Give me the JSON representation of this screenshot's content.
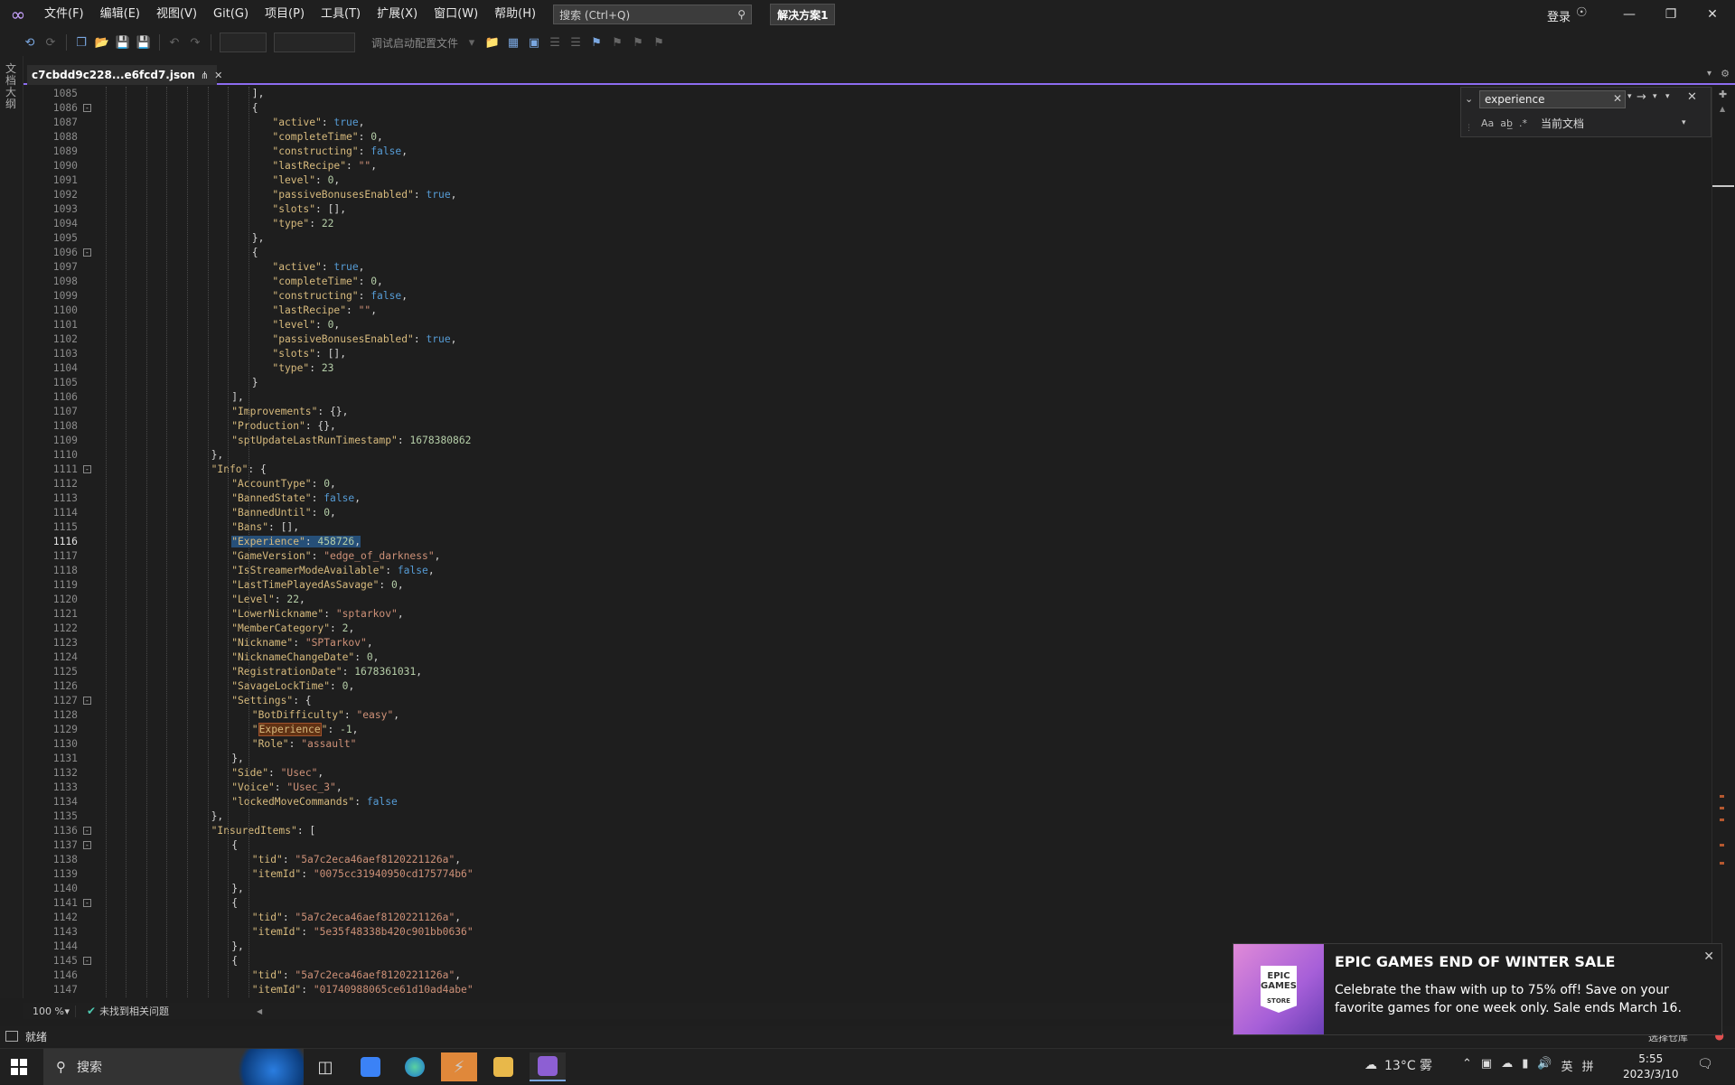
{
  "menubar": {
    "items": [
      "文件(F)",
      "编辑(E)",
      "视图(V)",
      "Git(G)",
      "项目(P)",
      "工具(T)",
      "扩展(X)",
      "窗口(W)",
      "帮助(H)"
    ],
    "search_placeholder": "搜索 (Ctrl+Q)",
    "solution_name": "解决方案1",
    "login_label": "登录"
  },
  "toolbar": {
    "debug_profile": "调试启动配置文件"
  },
  "sidebar": {
    "label": "文档大纲"
  },
  "tab": {
    "title": "c7cbdd9c228...e6fcd7.json"
  },
  "find": {
    "query": "experience",
    "scope": "当前文档",
    "match_case": "Aa",
    "whole_word": "ab̲",
    "regex": ".*"
  },
  "editor": {
    "current_line": 1116,
    "lines": [
      {
        "n": 1085,
        "i": 8,
        "t": [
          [
            "p",
            "],"
          ]
        ]
      },
      {
        "n": 1086,
        "i": 8,
        "t": [
          [
            "p",
            "{"
          ]
        ],
        "fold": true
      },
      {
        "n": 1087,
        "i": 9,
        "t": [
          [
            "k",
            "\"active\""
          ],
          [
            "p",
            ": "
          ],
          [
            "b",
            "true"
          ],
          [
            "p",
            ","
          ]
        ]
      },
      {
        "n": 1088,
        "i": 9,
        "t": [
          [
            "k",
            "\"completeTime\""
          ],
          [
            "p",
            ": "
          ],
          [
            "n",
            "0"
          ],
          [
            "p",
            ","
          ]
        ]
      },
      {
        "n": 1089,
        "i": 9,
        "t": [
          [
            "k",
            "\"constructing\""
          ],
          [
            "p",
            ": "
          ],
          [
            "b",
            "false"
          ],
          [
            "p",
            ","
          ]
        ]
      },
      {
        "n": 1090,
        "i": 9,
        "t": [
          [
            "k",
            "\"lastRecipe\""
          ],
          [
            "p",
            ": "
          ],
          [
            "s",
            "\"\""
          ],
          [
            "p",
            ","
          ]
        ]
      },
      {
        "n": 1091,
        "i": 9,
        "t": [
          [
            "k",
            "\"level\""
          ],
          [
            "p",
            ": "
          ],
          [
            "n",
            "0"
          ],
          [
            "p",
            ","
          ]
        ]
      },
      {
        "n": 1092,
        "i": 9,
        "t": [
          [
            "k",
            "\"passiveBonusesEnabled\""
          ],
          [
            "p",
            ": "
          ],
          [
            "b",
            "true"
          ],
          [
            "p",
            ","
          ]
        ]
      },
      {
        "n": 1093,
        "i": 9,
        "t": [
          [
            "k",
            "\"slots\""
          ],
          [
            "p",
            ": [],"
          ]
        ]
      },
      {
        "n": 1094,
        "i": 9,
        "t": [
          [
            "k",
            "\"type\""
          ],
          [
            "p",
            ": "
          ],
          [
            "n",
            "22"
          ]
        ]
      },
      {
        "n": 1095,
        "i": 8,
        "t": [
          [
            "p",
            "},"
          ]
        ]
      },
      {
        "n": 1096,
        "i": 8,
        "t": [
          [
            "p",
            "{"
          ]
        ],
        "fold": true
      },
      {
        "n": 1097,
        "i": 9,
        "t": [
          [
            "k",
            "\"active\""
          ],
          [
            "p",
            ": "
          ],
          [
            "b",
            "true"
          ],
          [
            "p",
            ","
          ]
        ]
      },
      {
        "n": 1098,
        "i": 9,
        "t": [
          [
            "k",
            "\"completeTime\""
          ],
          [
            "p",
            ": "
          ],
          [
            "n",
            "0"
          ],
          [
            "p",
            ","
          ]
        ]
      },
      {
        "n": 1099,
        "i": 9,
        "t": [
          [
            "k",
            "\"constructing\""
          ],
          [
            "p",
            ": "
          ],
          [
            "b",
            "false"
          ],
          [
            "p",
            ","
          ]
        ]
      },
      {
        "n": 1100,
        "i": 9,
        "t": [
          [
            "k",
            "\"lastRecipe\""
          ],
          [
            "p",
            ": "
          ],
          [
            "s",
            "\"\""
          ],
          [
            "p",
            ","
          ]
        ]
      },
      {
        "n": 1101,
        "i": 9,
        "t": [
          [
            "k",
            "\"level\""
          ],
          [
            "p",
            ": "
          ],
          [
            "n",
            "0"
          ],
          [
            "p",
            ","
          ]
        ]
      },
      {
        "n": 1102,
        "i": 9,
        "t": [
          [
            "k",
            "\"passiveBonusesEnabled\""
          ],
          [
            "p",
            ": "
          ],
          [
            "b",
            "true"
          ],
          [
            "p",
            ","
          ]
        ]
      },
      {
        "n": 1103,
        "i": 9,
        "t": [
          [
            "k",
            "\"slots\""
          ],
          [
            "p",
            ": [],"
          ]
        ]
      },
      {
        "n": 1104,
        "i": 9,
        "t": [
          [
            "k",
            "\"type\""
          ],
          [
            "p",
            ": "
          ],
          [
            "n",
            "23"
          ]
        ]
      },
      {
        "n": 1105,
        "i": 8,
        "t": [
          [
            "p",
            "}"
          ]
        ]
      },
      {
        "n": 1106,
        "i": 7,
        "t": [
          [
            "p",
            "],"
          ]
        ]
      },
      {
        "n": 1107,
        "i": 7,
        "t": [
          [
            "k",
            "\"Improvements\""
          ],
          [
            "p",
            ": {},"
          ]
        ]
      },
      {
        "n": 1108,
        "i": 7,
        "t": [
          [
            "k",
            "\"Production\""
          ],
          [
            "p",
            ": {},"
          ]
        ]
      },
      {
        "n": 1109,
        "i": 7,
        "t": [
          [
            "k",
            "\"sptUpdateLastRunTimestamp\""
          ],
          [
            "p",
            ": "
          ],
          [
            "n",
            "1678380862"
          ]
        ]
      },
      {
        "n": 1110,
        "i": 6,
        "t": [
          [
            "p",
            "},"
          ]
        ]
      },
      {
        "n": 1111,
        "i": 6,
        "t": [
          [
            "k",
            "\"Info\""
          ],
          [
            "p",
            ": {"
          ]
        ],
        "fold": true
      },
      {
        "n": 1112,
        "i": 7,
        "t": [
          [
            "k",
            "\"AccountType\""
          ],
          [
            "p",
            ": "
          ],
          [
            "n",
            "0"
          ],
          [
            "p",
            ","
          ]
        ]
      },
      {
        "n": 1113,
        "i": 7,
        "t": [
          [
            "k",
            "\"BannedState\""
          ],
          [
            "p",
            ": "
          ],
          [
            "b",
            "false"
          ],
          [
            "p",
            ","
          ]
        ]
      },
      {
        "n": 1114,
        "i": 7,
        "t": [
          [
            "k",
            "\"BannedUntil\""
          ],
          [
            "p",
            ": "
          ],
          [
            "n",
            "0"
          ],
          [
            "p",
            ","
          ]
        ]
      },
      {
        "n": 1115,
        "i": 7,
        "t": [
          [
            "k",
            "\"Bans\""
          ],
          [
            "p",
            ": [],"
          ]
        ]
      },
      {
        "n": 1116,
        "i": 7,
        "t": [
          [
            "k hl",
            "\"Experience\""
          ],
          [
            "p hl",
            ": "
          ],
          [
            "n hl",
            "458726"
          ],
          [
            "p hl",
            ","
          ]
        ]
      },
      {
        "n": 1117,
        "i": 7,
        "t": [
          [
            "k",
            "\"GameVersion\""
          ],
          [
            "p",
            ": "
          ],
          [
            "s",
            "\"edge_of_darkness\""
          ],
          [
            "p",
            ","
          ]
        ]
      },
      {
        "n": 1118,
        "i": 7,
        "t": [
          [
            "k",
            "\"IsStreamerModeAvailable\""
          ],
          [
            "p",
            ": "
          ],
          [
            "b",
            "false"
          ],
          [
            "p",
            ","
          ]
        ]
      },
      {
        "n": 1119,
        "i": 7,
        "t": [
          [
            "k",
            "\"LastTimePlayedAsSavage\""
          ],
          [
            "p",
            ": "
          ],
          [
            "n",
            "0"
          ],
          [
            "p",
            ","
          ]
        ]
      },
      {
        "n": 1120,
        "i": 7,
        "t": [
          [
            "k",
            "\"Level\""
          ],
          [
            "p",
            ": "
          ],
          [
            "n",
            "22"
          ],
          [
            "p",
            ","
          ]
        ]
      },
      {
        "n": 1121,
        "i": 7,
        "t": [
          [
            "k",
            "\"LowerNickname\""
          ],
          [
            "p",
            ": "
          ],
          [
            "s",
            "\"sptarkov\""
          ],
          [
            "p",
            ","
          ]
        ]
      },
      {
        "n": 1122,
        "i": 7,
        "t": [
          [
            "k",
            "\"MemberCategory\""
          ],
          [
            "p",
            ": "
          ],
          [
            "n",
            "2"
          ],
          [
            "p",
            ","
          ]
        ]
      },
      {
        "n": 1123,
        "i": 7,
        "t": [
          [
            "k",
            "\"Nickname\""
          ],
          [
            "p",
            ": "
          ],
          [
            "s",
            "\"SPTarkov\""
          ],
          [
            "p",
            ","
          ]
        ]
      },
      {
        "n": 1124,
        "i": 7,
        "t": [
          [
            "k",
            "\"NicknameChangeDate\""
          ],
          [
            "p",
            ": "
          ],
          [
            "n",
            "0"
          ],
          [
            "p",
            ","
          ]
        ]
      },
      {
        "n": 1125,
        "i": 7,
        "t": [
          [
            "k",
            "\"RegistrationDate\""
          ],
          [
            "p",
            ": "
          ],
          [
            "n",
            "1678361031"
          ],
          [
            "p",
            ","
          ]
        ]
      },
      {
        "n": 1126,
        "i": 7,
        "t": [
          [
            "k",
            "\"SavageLockTime\""
          ],
          [
            "p",
            ": "
          ],
          [
            "n",
            "0"
          ],
          [
            "p",
            ","
          ]
        ]
      },
      {
        "n": 1127,
        "i": 7,
        "t": [
          [
            "k",
            "\"Settings\""
          ],
          [
            "p",
            ": {"
          ]
        ],
        "fold": true
      },
      {
        "n": 1128,
        "i": 8,
        "t": [
          [
            "k",
            "\"BotDifficulty\""
          ],
          [
            "p",
            ": "
          ],
          [
            "s",
            "\"easy\""
          ],
          [
            "p",
            ","
          ]
        ]
      },
      {
        "n": 1129,
        "i": 8,
        "t": [
          [
            "k",
            "\""
          ],
          [
            "k hl2",
            "Experience"
          ],
          [
            "k",
            "\""
          ],
          [
            "p",
            ": "
          ],
          [
            "n",
            "-1"
          ],
          [
            "p",
            ","
          ]
        ]
      },
      {
        "n": 1130,
        "i": 8,
        "t": [
          [
            "k",
            "\"Role\""
          ],
          [
            "p",
            ": "
          ],
          [
            "s",
            "\"assault\""
          ]
        ]
      },
      {
        "n": 1131,
        "i": 7,
        "t": [
          [
            "p",
            "},"
          ]
        ]
      },
      {
        "n": 1132,
        "i": 7,
        "t": [
          [
            "k",
            "\"Side\""
          ],
          [
            "p",
            ": "
          ],
          [
            "s",
            "\"Usec\""
          ],
          [
            "p",
            ","
          ]
        ]
      },
      {
        "n": 1133,
        "i": 7,
        "t": [
          [
            "k",
            "\"Voice\""
          ],
          [
            "p",
            ": "
          ],
          [
            "s",
            "\"Usec_3\""
          ],
          [
            "p",
            ","
          ]
        ]
      },
      {
        "n": 1134,
        "i": 7,
        "t": [
          [
            "k",
            "\"lockedMoveCommands\""
          ],
          [
            "p",
            ": "
          ],
          [
            "b",
            "false"
          ]
        ]
      },
      {
        "n": 1135,
        "i": 6,
        "t": [
          [
            "p",
            "},"
          ]
        ]
      },
      {
        "n": 1136,
        "i": 6,
        "t": [
          [
            "k",
            "\"InsuredItems\""
          ],
          [
            "p",
            ": ["
          ]
        ],
        "fold": true
      },
      {
        "n": 1137,
        "i": 7,
        "t": [
          [
            "p",
            "{"
          ]
        ],
        "fold": true
      },
      {
        "n": 1138,
        "i": 8,
        "t": [
          [
            "k",
            "\"tid\""
          ],
          [
            "p",
            ": "
          ],
          [
            "s",
            "\"5a7c2eca46aef8120221126a\""
          ],
          [
            "p",
            ","
          ]
        ]
      },
      {
        "n": 1139,
        "i": 8,
        "t": [
          [
            "k",
            "\"itemId\""
          ],
          [
            "p",
            ": "
          ],
          [
            "s",
            "\"0075cc31940950cd175774b6\""
          ]
        ]
      },
      {
        "n": 1140,
        "i": 7,
        "t": [
          [
            "p",
            "},"
          ]
        ]
      },
      {
        "n": 1141,
        "i": 7,
        "t": [
          [
            "p",
            "{"
          ]
        ],
        "fold": true
      },
      {
        "n": 1142,
        "i": 8,
        "t": [
          [
            "k",
            "\"tid\""
          ],
          [
            "p",
            ": "
          ],
          [
            "s",
            "\"5a7c2eca46aef8120221126a\""
          ],
          [
            "p",
            ","
          ]
        ]
      },
      {
        "n": 1143,
        "i": 8,
        "t": [
          [
            "k",
            "\"itemId\""
          ],
          [
            "p",
            ": "
          ],
          [
            "s",
            "\"5e35f48338b420c901bb0636\""
          ]
        ]
      },
      {
        "n": 1144,
        "i": 7,
        "t": [
          [
            "p",
            "},"
          ]
        ]
      },
      {
        "n": 1145,
        "i": 7,
        "t": [
          [
            "p",
            "{"
          ]
        ],
        "fold": true
      },
      {
        "n": 1146,
        "i": 8,
        "t": [
          [
            "k",
            "\"tid\""
          ],
          [
            "p",
            ": "
          ],
          [
            "s",
            "\"5a7c2eca46aef8120221126a\""
          ],
          [
            "p",
            ","
          ]
        ]
      },
      {
        "n": 1147,
        "i": 8,
        "t": [
          [
            "k",
            "\"itemId\""
          ],
          [
            "p",
            ": "
          ],
          [
            "s",
            "\"01740988065ce61d10ad4abe\""
          ]
        ]
      }
    ]
  },
  "bottom": {
    "zoom": "100 %",
    "issues": "未找到相关问题"
  },
  "status": {
    "text": "就绪",
    "repo": "选择仓库"
  },
  "toast": {
    "logo_line1": "EPIC",
    "logo_line2": "GAMES",
    "logo_line3": "STORE",
    "title": "EPIC GAMES END OF WINTER SALE",
    "body": "Celebrate the thaw with up to 75% off! Save on your favorite games for one week only. Sale ends March 16."
  },
  "taskbar": {
    "search_label": "搜索",
    "weather": "13°C 雾",
    "ime": "英",
    "ime2": "拼",
    "time": "5:55",
    "date": "2023/3/10"
  }
}
